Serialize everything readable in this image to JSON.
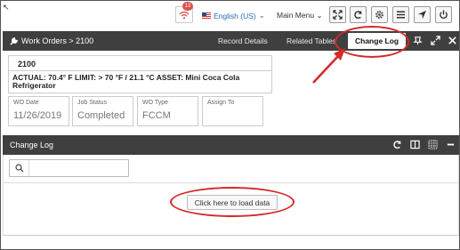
{
  "topbar": {
    "notification_count": "13",
    "language": "English (US)",
    "main_menu": "Main Menu"
  },
  "header": {
    "breadcrumb": "Work Orders > 2100",
    "tabs": [
      "Record Details",
      "Related Tables",
      "Change Log"
    ]
  },
  "work_order": {
    "number": "2100",
    "description": "ACTUAL: 70.4° F LIMIT: > 70 °F / 21.1 °C ASSET: Mini Coca Cola Refrigerator",
    "fields": [
      {
        "label": "WO Date",
        "value": "11/26/2019"
      },
      {
        "label": "Job Status",
        "value": "Completed"
      },
      {
        "label": "WO Type",
        "value": "FCCM"
      },
      {
        "label": "Assign To",
        "value": ""
      }
    ]
  },
  "change_log": {
    "title": "Change Log",
    "search_placeholder": "",
    "load_button": "Click here to load data"
  },
  "annotation_color": "#d42a2a"
}
